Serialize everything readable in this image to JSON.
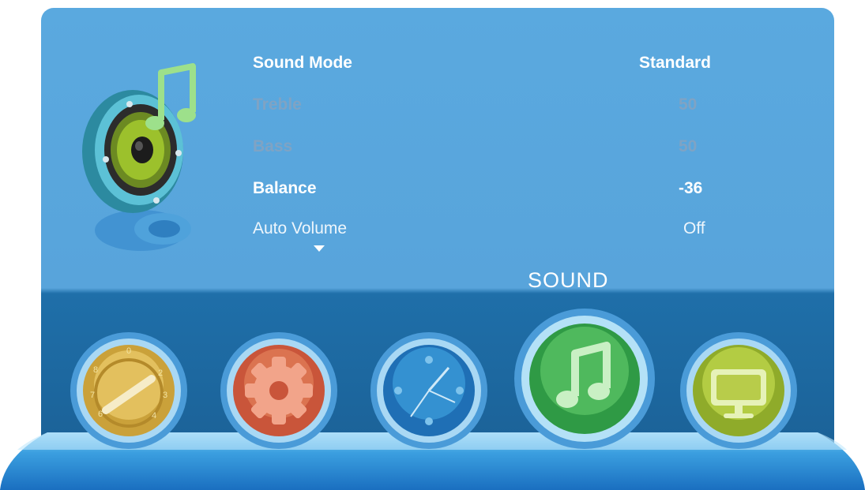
{
  "menu": {
    "section_title": "SOUND",
    "items": [
      {
        "label": "Sound Mode",
        "value": "Standard",
        "state": "title"
      },
      {
        "label": "Treble",
        "value": "50",
        "state": "disabled"
      },
      {
        "label": "Bass",
        "value": "50",
        "state": "disabled"
      },
      {
        "label": "Balance",
        "value": "-36",
        "state": "active"
      },
      {
        "label": "Auto Volume",
        "value": "Off",
        "state": "normal"
      }
    ]
  },
  "tabs": [
    {
      "id": "picture",
      "icon": "dial-icon",
      "color": "#d9b64a"
    },
    {
      "id": "setup",
      "icon": "gear-icon",
      "color": "#d2603f"
    },
    {
      "id": "time",
      "icon": "clock-icon",
      "color": "#2f8fcf"
    },
    {
      "id": "sound",
      "icon": "music-note-icon",
      "color": "#46b24e",
      "selected": true
    },
    {
      "id": "screen",
      "icon": "monitor-icon",
      "color": "#a7c23c"
    }
  ],
  "colors": {
    "panel": "#58a4db",
    "dock": "#1a5f94"
  }
}
